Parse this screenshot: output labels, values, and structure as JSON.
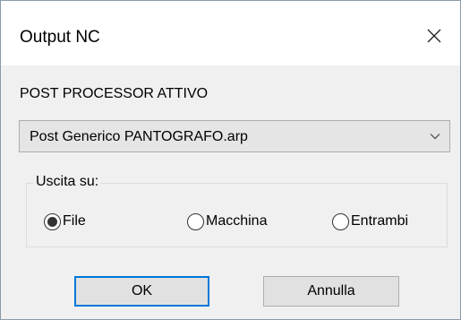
{
  "dialog": {
    "title": "Output NC",
    "close_icon": "close-icon"
  },
  "post_processor": {
    "label": "POST PROCESSOR ATTIVO",
    "selected": "Post Generico PANTOGRAFO.arp",
    "arrow_icon": "chevron-down-icon"
  },
  "output": {
    "group_label": "Uscita su:",
    "options": [
      {
        "label": "File",
        "checked": true
      },
      {
        "label": "Macchina",
        "checked": false
      },
      {
        "label": "Entrambi",
        "checked": false
      }
    ]
  },
  "buttons": {
    "ok_label": "OK",
    "cancel_label": "Annulla"
  },
  "colors": {
    "accent": "#0078d7",
    "dialog_bg": "#f0f0f0",
    "titlebar_bg": "#ffffff",
    "combo_bg": "#e5e5e5",
    "button_bg": "#e1e1e1"
  }
}
